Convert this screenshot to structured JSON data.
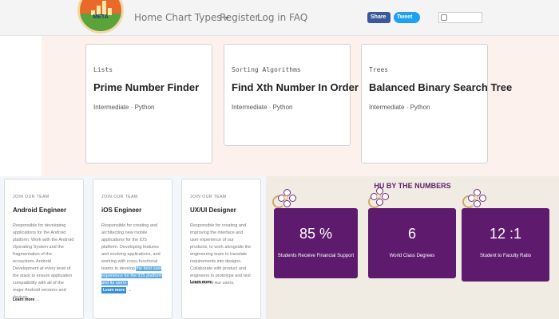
{
  "nav": {
    "logo_text": "META",
    "links": [
      "Home",
      "Chart Types",
      "Register",
      "Log in",
      "FAQ"
    ],
    "share_label": "Share",
    "tweet_label": "Tweet"
  },
  "problems": [
    {
      "category": "Lists",
      "title": "Prime Number Finder",
      "level": "Intermediate · Python"
    },
    {
      "category": "Sorting Algorithms",
      "title": "Find Xth Number In Order",
      "level": "Intermediate · Python"
    },
    {
      "category": "Trees",
      "title": "Balanced Binary Search Tree",
      "level": "Intermediate · Python"
    }
  ],
  "jobs": [
    {
      "tag": "JOIN OUR TEAM",
      "role": "Android Engineer",
      "description": "Responsible for developing applications for the Android platform. Work with the Android Operating System and the fragmentation of the ecosystem. Android Development at every level of the stack to ensure application compatibility with all of the major Android versions and devices.",
      "learn_more": "Learn more"
    },
    {
      "tag": "JOIN OUR TEAM",
      "role": "iOS Engineer",
      "description": "Responsible for creating and architecting new mobile applications for the iOS platform. Developing features and evolving applications, and working with cross-functional teams to develop",
      "description_highlight": "the best user experience for the iOS platform and its users.",
      "learn_more": "Learn more"
    },
    {
      "tag": "JOIN OUR TEAM",
      "role": "UX/UI Designer",
      "description": "Responsible for creating and improving the interface and user experience of our products, to work alongside the engineering team to translate requirements into designs. Collaborate with product and engineers to prototype and test solutions for our users.",
      "learn_more": "Learn more"
    }
  ],
  "stats": {
    "title": "HU BY THE NUMBERS",
    "items": [
      {
        "value": "85 %",
        "label": "Students Receive Financial Support"
      },
      {
        "value": "6",
        "label": "World Class Degrees"
      },
      {
        "value": "12 :1",
        "label": "Student to Faculty Ratio"
      }
    ]
  },
  "colors": {
    "stat_purple": "#5e1b6e",
    "stats_bg": "#f1ece3",
    "upper_bg": "#fcf1ed",
    "highlight_blue": "#5aa8e6"
  }
}
